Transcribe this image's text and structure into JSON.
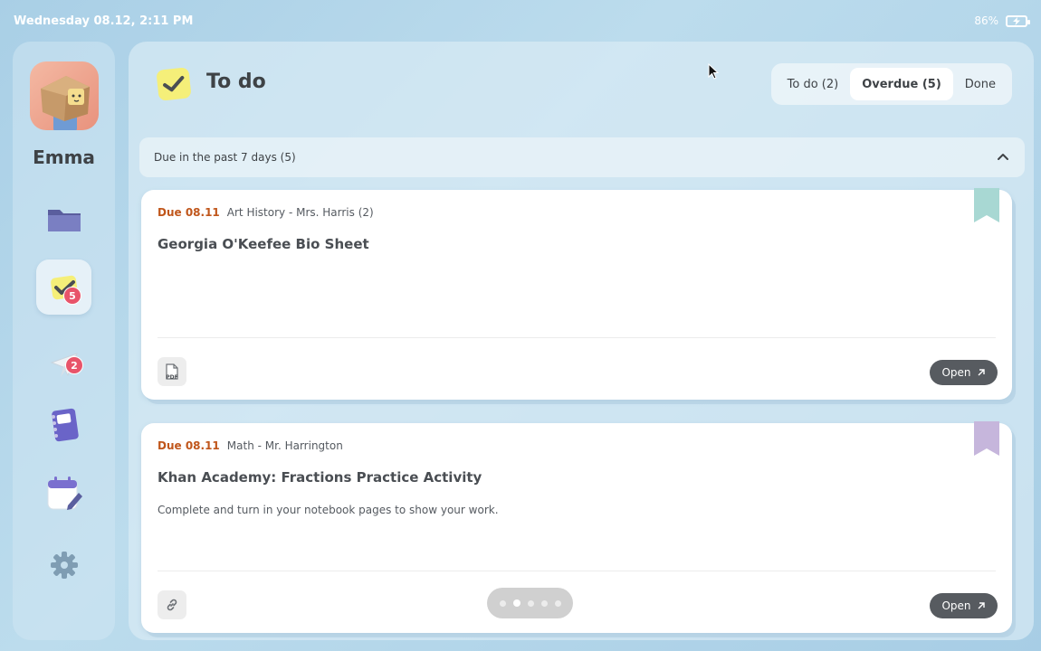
{
  "status_bar": {
    "datetime": "Wednesday 08.12, 2:11 PM",
    "battery_percent": "86%"
  },
  "sidebar": {
    "user_name": "Emma",
    "items": [
      {
        "icon": "folder-icon",
        "badge": ""
      },
      {
        "icon": "todo-check-icon",
        "badge": "5",
        "active": true
      },
      {
        "icon": "paper-plane-icon",
        "badge": "2"
      },
      {
        "icon": "notebook-icon",
        "badge": ""
      },
      {
        "icon": "calendar-icon",
        "badge": ""
      },
      {
        "icon": "gear-icon",
        "badge": ""
      }
    ]
  },
  "header": {
    "title": "To do",
    "tabs": [
      {
        "label": "To do (2)",
        "active": false
      },
      {
        "label": "Overdue (5)",
        "active": true
      },
      {
        "label": "Done",
        "active": false
      }
    ]
  },
  "section": {
    "title": "Due in the past 7 days (5)"
  },
  "cards": [
    {
      "due": "Due 08.11",
      "course": "Art History - Mrs. Harris (2)",
      "title": "Georgia O'Keefee Bio Sheet",
      "description": "",
      "attachment": "PDF",
      "open_label": "Open",
      "bookmark_color": "#a8d8d3"
    },
    {
      "due": "Due 08.11",
      "course": "Math - Mr. Harrington",
      "title": "Khan Academy: Fractions Practice Activity",
      "description": "Complete and turn in your notebook pages to show your work.",
      "attachment": "link",
      "open_label": "Open",
      "bookmark_color": "#c6b6dc"
    }
  ],
  "pager": {
    "count": 5,
    "active": 2
  },
  "colors": {
    "due": "#c0561b",
    "badge": "#e8546a",
    "open_button": "#575b60"
  }
}
